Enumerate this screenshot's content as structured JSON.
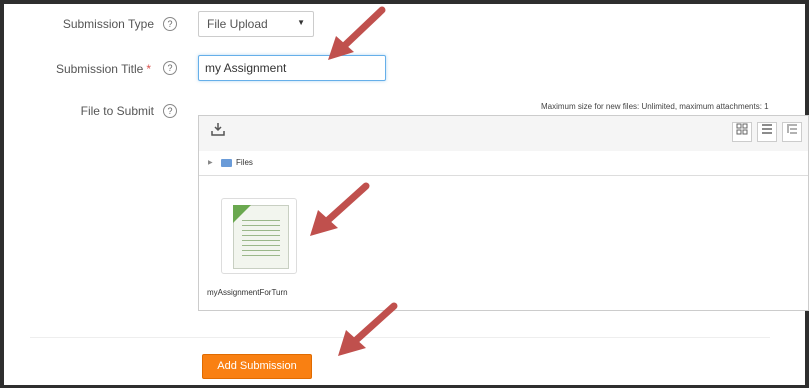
{
  "form": {
    "submission_type": {
      "label": "Submission Type",
      "help": "?",
      "value": "File Upload"
    },
    "submission_title": {
      "label": "Submission Title",
      "required_mark": "*",
      "help": "?",
      "value": "my Assignment"
    },
    "file_to_submit": {
      "label": "File to Submit",
      "help": "?"
    }
  },
  "filepicker": {
    "max_size_text": "Maximum size for new files: Unlimited, maximum attachments: 1",
    "path_folder": "Files",
    "files": [
      {
        "name": "myAssignmentForTurn",
        "icon": "document-icon"
      }
    ],
    "toolbar": {
      "add_icon": "download-icon",
      "view_icons": [
        "grid-view-icon",
        "list-view-icon",
        "tree-view-icon"
      ]
    }
  },
  "actions": {
    "add_submission": "Add Submission"
  },
  "colors": {
    "accent": "#f98012",
    "arrow": "#c0504d",
    "focus": "#66afe9"
  }
}
